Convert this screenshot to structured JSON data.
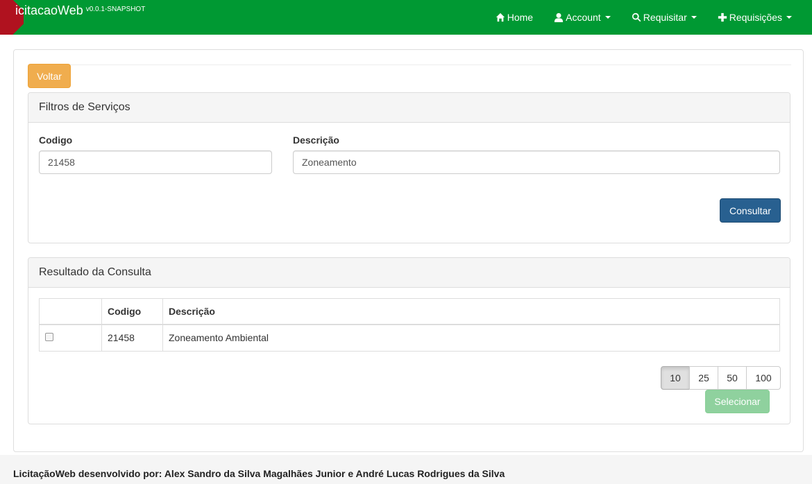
{
  "navbar": {
    "brand": "icitacaoWeb",
    "version": "v0.0.1-SNAPSHOT",
    "items": [
      {
        "label": "Home",
        "icon": "home-icon"
      },
      {
        "label": "Account",
        "icon": "user-icon"
      },
      {
        "label": "Requisitar",
        "icon": "search-icon"
      },
      {
        "label": "Requisições",
        "icon": "plus-icon"
      }
    ],
    "colors": {
      "background": "#009933",
      "ribbon": "#b0121f"
    }
  },
  "actions": {
    "voltar_label": "Voltar"
  },
  "filtros": {
    "title": "Filtros de Serviços",
    "codigo_label": "Codigo",
    "codigo_value": "21458",
    "descricao_label": "Descrição",
    "descricao_value": "Zoneamento",
    "consultar_label": "Consultar"
  },
  "resultado": {
    "title": "Resultado da Consulta",
    "columns": [
      "",
      "Codigo",
      "Descrição"
    ],
    "rows": [
      {
        "checked": false,
        "codigo": "21458",
        "descricao": "Zoneamento Ambiental"
      }
    ],
    "page_sizes": [
      "10",
      "25",
      "50",
      "100"
    ],
    "selected_page_size": "10",
    "selecionar_label": "Selecionar"
  },
  "footer": {
    "text": "LicitaçãoWeb desenvolvido por: Alex Sandro da Silva Magalhães Junior e André Lucas Rodrigues da Silva"
  }
}
